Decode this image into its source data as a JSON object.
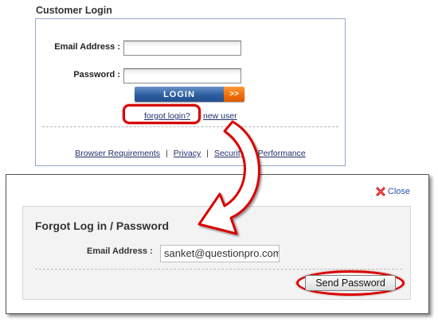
{
  "login": {
    "title": "Customer Login",
    "email_label": "Email Address :",
    "password_label": "Password :",
    "login_button": "LOGIN",
    "login_arrow": ">>",
    "forgot_link": "forgot login?",
    "new_user_link": "new user",
    "footer_links": [
      "Browser Requirements",
      "Privacy",
      "Security",
      "Performance"
    ],
    "footer_separator": "|"
  },
  "dialog": {
    "close_label": "Close",
    "title": "Forgot Log in / Password",
    "email_label": "Email Address :",
    "email_value": "sanket@questionpro.com",
    "send_button": "Send Password"
  },
  "colors": {
    "highlight_red": "#d90000",
    "login_blue": "#2c5ea1",
    "login_orange": "#ef6b00",
    "link_blue": "#1f2f6b"
  },
  "icons": {
    "close": "red-x-icon",
    "annotation": "curved-red-arrow"
  }
}
